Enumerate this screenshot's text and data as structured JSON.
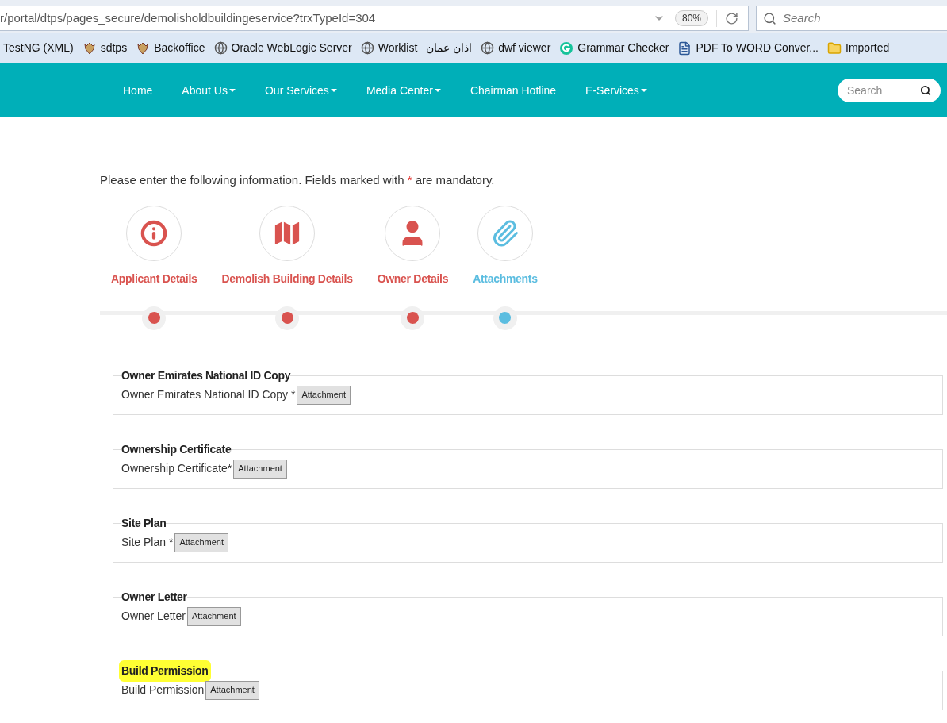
{
  "browser": {
    "url": "r/portal/dtps/pages_secure/demolisholdbuildingeservice?trxTypeId=304",
    "zoom": "80%",
    "search_placeholder": "Search",
    "bookmarks": [
      {
        "label": "TestNG (XML)",
        "kind": "none"
      },
      {
        "label": "sdtps",
        "kind": "emblem"
      },
      {
        "label": "Backoffice",
        "kind": "emblem"
      },
      {
        "label": "Oracle WebLogic Server",
        "kind": "globe"
      },
      {
        "label": "Worklist",
        "kind": "globe"
      },
      {
        "label": "اذان عمان",
        "kind": "none"
      },
      {
        "label": "dwf viewer",
        "kind": "globe"
      },
      {
        "label": "Grammar Checker",
        "kind": "grammar"
      },
      {
        "label": "PDF To WORD Conver...",
        "kind": "document"
      },
      {
        "label": "Imported",
        "kind": "folder"
      }
    ]
  },
  "nav": {
    "items": [
      {
        "label": "Home",
        "dropdown": false
      },
      {
        "label": "About Us",
        "dropdown": true
      },
      {
        "label": "Our Services",
        "dropdown": true
      },
      {
        "label": "Media Center",
        "dropdown": true
      },
      {
        "label": "Chairman Hotline",
        "dropdown": false
      },
      {
        "label": "E-Services",
        "dropdown": true
      }
    ],
    "search_placeholder": "Search"
  },
  "intro": {
    "before": "Please enter the following information. Fields marked with",
    "mark": "*",
    "after": "are mandatory."
  },
  "steps": [
    {
      "label": "Applicant Details",
      "kind": "info",
      "selected": false
    },
    {
      "label": "Demolish Building Details",
      "kind": "map",
      "selected": false
    },
    {
      "label": "Owner Details",
      "kind": "person",
      "selected": false
    },
    {
      "label": "Attachments",
      "kind": "paperclip",
      "selected": true
    }
  ],
  "sections": [
    {
      "legend": "Owner Emirates National ID Copy",
      "label": "Owner Emirates National ID Copy *",
      "button": "Attachment",
      "highlighted": false
    },
    {
      "legend": "Ownership Certificate",
      "label": "Ownership Certificate*",
      "button": "Attachment",
      "highlighted": false
    },
    {
      "legend": "Site Plan",
      "label": "Site Plan *",
      "button": "Attachment",
      "highlighted": false
    },
    {
      "legend": "Owner Letter",
      "label": "Owner Letter",
      "button": "Attachment",
      "highlighted": false
    },
    {
      "legend": "Build Permission",
      "label": "Build Permission",
      "button": "Attachment",
      "highlighted": true
    }
  ]
}
